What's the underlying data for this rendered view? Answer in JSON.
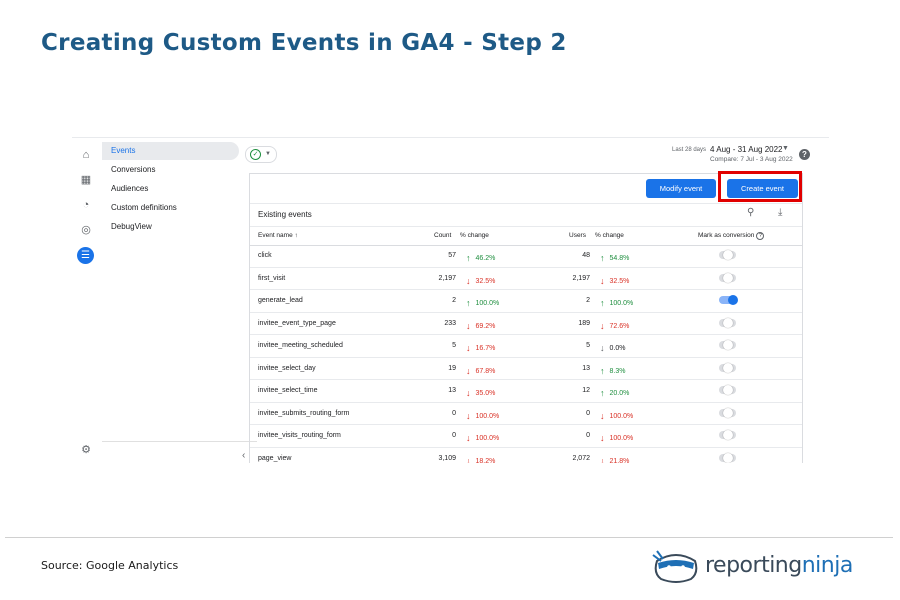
{
  "slide": {
    "title": "Creating Custom Events in GA4 - Step 2",
    "source": "Source: Google Analytics",
    "logo": {
      "part1": "reporting",
      "part2": "ninja"
    }
  },
  "rail": {
    "icons": [
      "home-icon",
      "reports-icon",
      "explore-icon",
      "advertising-icon",
      "configure-icon"
    ],
    "bottom_icon": "settings-icon"
  },
  "subnav": {
    "items": [
      {
        "label": "Events",
        "active": true
      },
      {
        "label": "Conversions",
        "active": false
      },
      {
        "label": "Audiences",
        "active": false
      },
      {
        "label": "Custom definitions",
        "active": false
      },
      {
        "label": "DebugView",
        "active": false
      }
    ],
    "collapse_glyph": "‹"
  },
  "header": {
    "date_range_label": "Last 28 days",
    "date_range": "4 Aug - 31 Aug 2022",
    "compare": "Compare: 7 Jul - 3 Aug 2022"
  },
  "buttons": {
    "modify": "Modify event",
    "create": "Create event"
  },
  "table": {
    "section_title": "Existing events",
    "headers": {
      "event_name": "Event name ↑",
      "count": "Count",
      "count_change": "% change",
      "users": "Users",
      "users_change": "% change",
      "mark": "Mark as conversion"
    },
    "rows": [
      {
        "name": "click",
        "count": "57",
        "count_change": "46.2%",
        "count_dir": "up",
        "users": "48",
        "users_change": "54.8%",
        "users_dir": "up",
        "conversion": false
      },
      {
        "name": "first_visit",
        "count": "2,197",
        "count_change": "32.5%",
        "count_dir": "down",
        "users": "2,197",
        "users_change": "32.5%",
        "users_dir": "down",
        "conversion": false
      },
      {
        "name": "generate_lead",
        "count": "2",
        "count_change": "100.0%",
        "count_dir": "up",
        "users": "2",
        "users_change": "100.0%",
        "users_dir": "up",
        "conversion": true
      },
      {
        "name": "invitee_event_type_page",
        "count": "233",
        "count_change": "69.2%",
        "count_dir": "down",
        "users": "189",
        "users_change": "72.6%",
        "users_dir": "down",
        "conversion": false
      },
      {
        "name": "invitee_meeting_scheduled",
        "count": "5",
        "count_change": "16.7%",
        "count_dir": "down",
        "users": "5",
        "users_change": "0.0%",
        "users_dir": "neutral",
        "conversion": false
      },
      {
        "name": "invitee_select_day",
        "count": "19",
        "count_change": "67.8%",
        "count_dir": "down",
        "users": "13",
        "users_change": "8.3%",
        "users_dir": "up",
        "conversion": false
      },
      {
        "name": "invitee_select_time",
        "count": "13",
        "count_change": "35.0%",
        "count_dir": "down",
        "users": "12",
        "users_change": "20.0%",
        "users_dir": "up",
        "conversion": false
      },
      {
        "name": "invitee_submits_routing_form",
        "count": "0",
        "count_change": "100.0%",
        "count_dir": "down",
        "users": "0",
        "users_change": "100.0%",
        "users_dir": "down",
        "conversion": false
      },
      {
        "name": "invitee_visits_routing_form",
        "count": "0",
        "count_change": "100.0%",
        "count_dir": "down",
        "users": "0",
        "users_change": "100.0%",
        "users_dir": "down",
        "conversion": false
      },
      {
        "name": "page_view",
        "count": "3,109",
        "count_change": "18.2%",
        "count_dir": "down",
        "users": "2,072",
        "users_change": "21.8%",
        "users_dir": "down",
        "conversion": false
      }
    ]
  },
  "colors": {
    "title": "#1e5a86",
    "primary": "#1a73e8",
    "up": "#1e8e3e",
    "down": "#d93025",
    "highlight": "#e10000"
  }
}
